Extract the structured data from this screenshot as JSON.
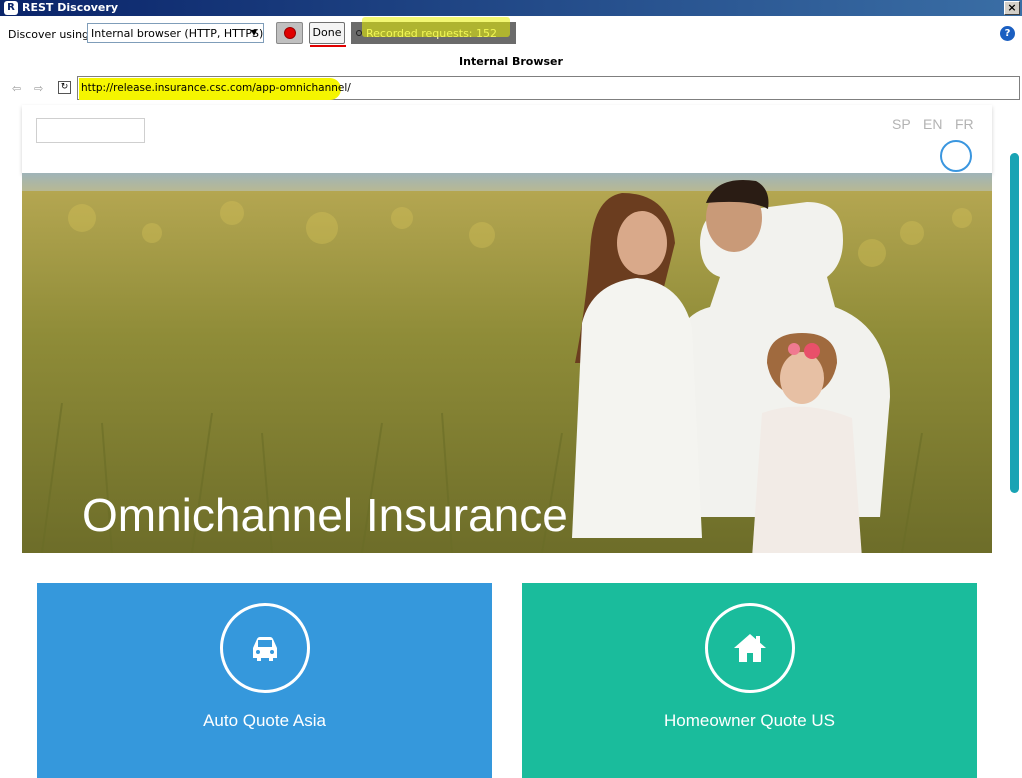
{
  "window": {
    "title": "REST Discovery",
    "app_icon": "R",
    "close": "×"
  },
  "toolbar": {
    "discover_label": "Discover using:",
    "mode_value": "Internal browser (HTTP, HTTPS)",
    "done_label": "Done",
    "recorded_label": "Recorded requests:",
    "recorded_count": "152",
    "help": "?"
  },
  "browser": {
    "section_title": "Internal Browser",
    "url": "http://release.insurance.csc.com/app-omnichannel/"
  },
  "page": {
    "languages": [
      "SP",
      "EN",
      "FR"
    ],
    "hero_title": "Omnichannel Insurance",
    "cards": [
      {
        "label": "Auto Quote Asia",
        "icon": "car-icon",
        "color": "#3598dc"
      },
      {
        "label": "Homeowner Quote US",
        "icon": "home-icon",
        "color": "#1abc9c"
      }
    ]
  },
  "colors": {
    "title_bar": "#0a246a",
    "highlight": "#f5f500",
    "record": "#e00000",
    "scrollbar": "#19a3b4"
  }
}
